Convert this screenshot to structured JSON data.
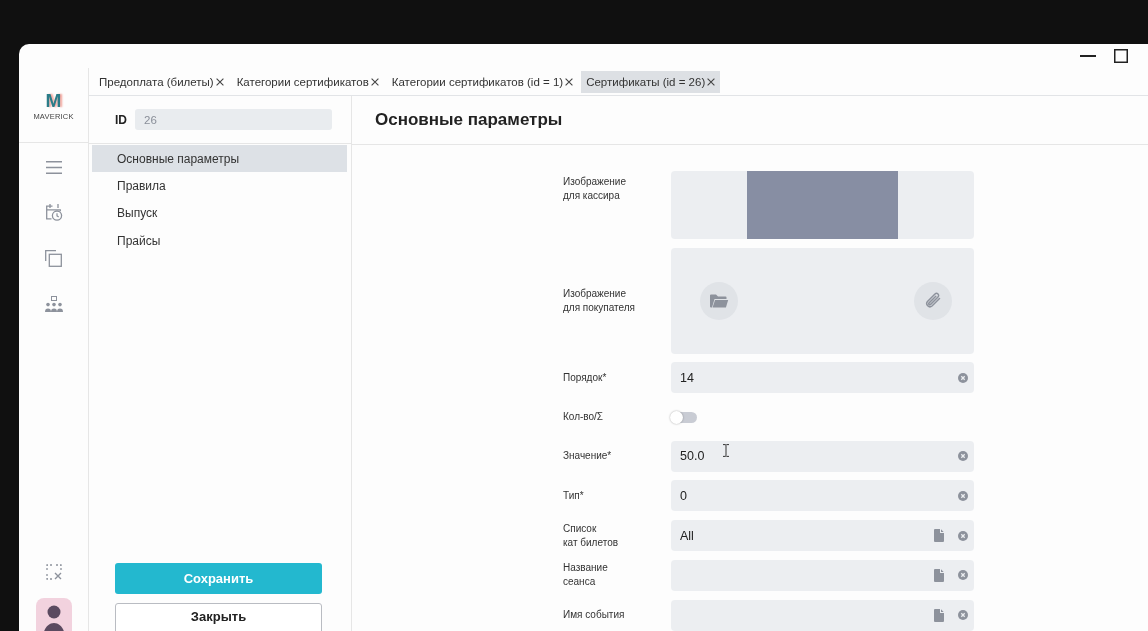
{
  "rail": {
    "logo": {
      "mark": "M",
      "name": "MAVERICK"
    }
  },
  "tabs": [
    {
      "label": "Предоплата (билеты)",
      "selected": false
    },
    {
      "label": "Категории сертификатов",
      "selected": false
    },
    {
      "label": "Категории сертификатов (id = 1)",
      "selected": false
    },
    {
      "label": "Сертификаты (id = 26)",
      "selected": true
    }
  ],
  "record": {
    "id_label": "ID",
    "id_value": "26"
  },
  "sections": [
    {
      "label": "Основные параметры",
      "selected": true
    },
    {
      "label": "Правила",
      "selected": false
    },
    {
      "label": "Выпуск",
      "selected": false
    },
    {
      "label": "Прайсы",
      "selected": false
    }
  ],
  "actions": [
    {
      "label": "Сохранить",
      "kind": "primary"
    },
    {
      "label": "Закрыть",
      "kind": "secondary"
    }
  ],
  "content": {
    "title": "Основные параметры",
    "fields": [
      {
        "kind": "image",
        "label": "Изображение\nдля кассира",
        "has_image": true
      },
      {
        "kind": "upload",
        "label": "Изображение\nдля покупателя"
      },
      {
        "kind": "text",
        "label": "Порядок*",
        "value": "14"
      },
      {
        "kind": "toggle",
        "label": "Кол-во/Σ",
        "on": false
      },
      {
        "kind": "text",
        "label": "Значение*",
        "value": "50.0"
      },
      {
        "kind": "text",
        "label": "Тип*",
        "value": "0"
      },
      {
        "kind": "picker",
        "label": "Список\nкат билетов",
        "value": "All"
      },
      {
        "kind": "picker",
        "label": "Название\nсеанса"
      },
      {
        "kind": "picker",
        "label": "Имя события"
      }
    ]
  },
  "mouse_pointer": {
    "kind": "text"
  }
}
